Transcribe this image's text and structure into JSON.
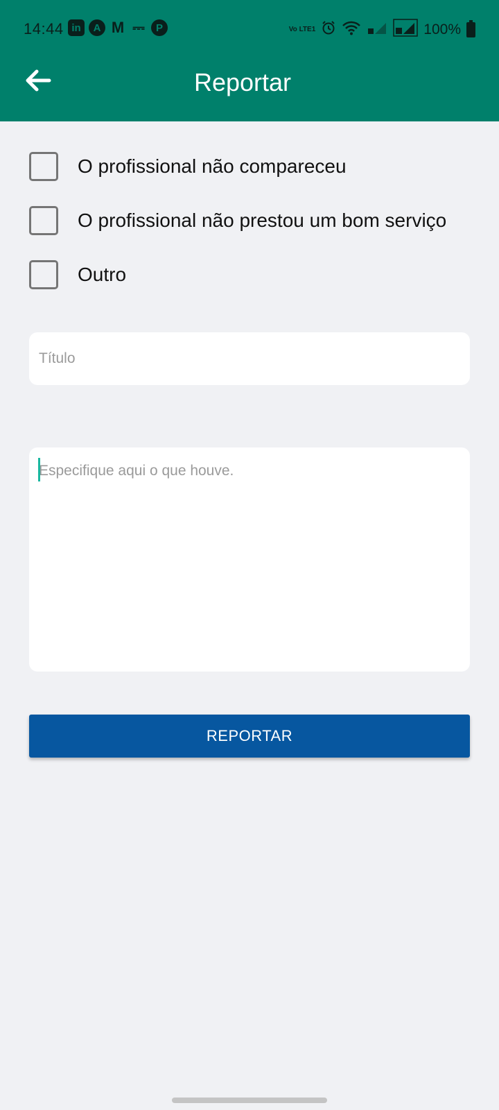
{
  "status_bar": {
    "time": "14:44",
    "left_icons": [
      "linkedin-icon",
      "arc-icon",
      "gmail-icon",
      "usb-icon",
      "app-icon"
    ],
    "volte": "Vo LTE1",
    "battery": "100%"
  },
  "header": {
    "title": "Reportar",
    "background": "#00806b"
  },
  "options": [
    {
      "label": "O profissional não compareceu",
      "checked": false
    },
    {
      "label": "O profissional não prestou um bom serviço",
      "checked": false
    },
    {
      "label": "Outro",
      "checked": false
    }
  ],
  "title_field": {
    "placeholder": "Título",
    "value": ""
  },
  "description_field": {
    "placeholder": "Especifique aqui o que houve.",
    "value": ""
  },
  "submit": {
    "label": "REPORTAR",
    "color": "#0757a0"
  }
}
